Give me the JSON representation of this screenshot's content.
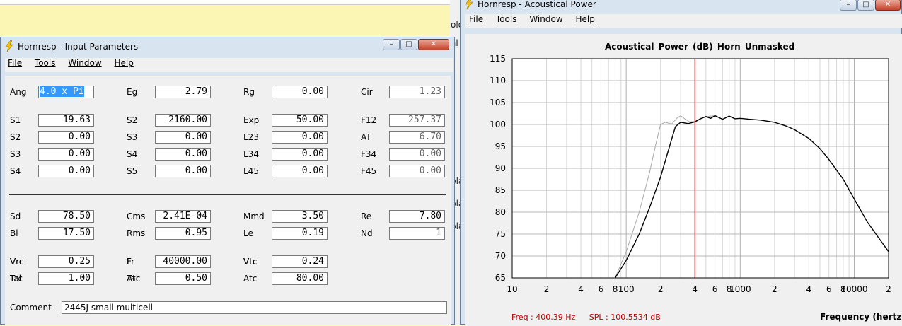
{
  "background": {
    "partial_labels": [
      "olo",
      "al",
      "pla",
      "pla",
      "pla"
    ]
  },
  "input_window": {
    "title": "Hornresp - Input Parameters",
    "menu": [
      "File",
      "Tools",
      "Window",
      "Help"
    ],
    "params": [
      {
        "label": "Ang",
        "value": "4.0 x Pi",
        "selected": true
      },
      {
        "label": "Eg",
        "value": "2.79"
      },
      {
        "label": "Rg",
        "value": "0.00"
      },
      {
        "label": "Cir",
        "value": "1.23",
        "readonly": true
      },
      {
        "label": "S1",
        "value": "19.63"
      },
      {
        "label": "S2",
        "value": "2160.00"
      },
      {
        "label": "Exp",
        "value": "50.00"
      },
      {
        "label": "F12",
        "value": "257.37",
        "readonly": true
      },
      {
        "label": "S2",
        "value": "0.00"
      },
      {
        "label": "S3",
        "value": "0.00"
      },
      {
        "label": "L23",
        "value": "0.00"
      },
      {
        "label": "AT",
        "value": "6.70",
        "readonly": true
      },
      {
        "label": "S3",
        "value": "0.00"
      },
      {
        "label": "S4",
        "value": "0.00"
      },
      {
        "label": "L34",
        "value": "0.00"
      },
      {
        "label": "F34",
        "value": "0.00",
        "readonly": true
      },
      {
        "label": "S4",
        "value": "0.00"
      },
      {
        "label": "S5",
        "value": "0.00"
      },
      {
        "label": "L45",
        "value": "0.00"
      },
      {
        "label": "F45",
        "value": "0.00",
        "readonly": true
      },
      {
        "label": "Sd",
        "value": "78.50"
      },
      {
        "label": "Cms",
        "value": "2.41E-04"
      },
      {
        "label": "Mmd",
        "value": "3.50"
      },
      {
        "label": "Re",
        "value": "7.80"
      },
      {
        "label": "Bl",
        "value": "17.50"
      },
      {
        "label": "Rms",
        "value": "0.95"
      },
      {
        "label": "Le",
        "value": "0.19"
      },
      {
        "label": "Nd",
        "value": "1",
        "readonly": true
      },
      {
        "label": "Vrc",
        "value": "0.25"
      },
      {
        "label": "Fr",
        "value": "40000.00"
      },
      {
        "label": "Vtc",
        "value": "0.24"
      },
      {
        "label": "Lrc",
        "value": "1.00"
      },
      {
        "label": "Tal",
        "value": "0.50"
      },
      {
        "label": "Atc",
        "value": "80.00"
      }
    ],
    "comment_label": "Comment",
    "comment_value": "2445J small multicell"
  },
  "chart_window": {
    "title": "Hornresp - Acoustical Power",
    "menu": [
      "File",
      "Tools",
      "Window",
      "Help"
    ],
    "chart_title": "Acoustical Power (dB)   Horn   Unmasked",
    "readout_freq": "Freq : 400.39 Hz",
    "readout_spl": "SPL : 100.5534 dB",
    "x_caption": "Frequency (hertz)"
  },
  "chart_data": {
    "type": "line",
    "title": "Acoustical Power (dB)   Horn   Unmasked",
    "xlabel": "Frequency (hertz)",
    "ylabel": "",
    "xscale": "log",
    "xlim": [
      10,
      20000
    ],
    "ylim": [
      65,
      115
    ],
    "yticks": [
      115,
      110,
      105,
      100,
      95,
      90,
      85,
      80,
      75,
      70,
      65
    ],
    "xtick_labels": [
      {
        "x": 10,
        "label": "10"
      },
      {
        "x": 20,
        "label": "2"
      },
      {
        "x": 40,
        "label": "4"
      },
      {
        "x": 60,
        "label": "6"
      },
      {
        "x": 80,
        "label": "8"
      },
      {
        "x": 100,
        "label": "100"
      },
      {
        "x": 200,
        "label": "2"
      },
      {
        "x": 400,
        "label": "4"
      },
      {
        "x": 600,
        "label": "6"
      },
      {
        "x": 800,
        "label": "8"
      },
      {
        "x": 1000,
        "label": "1000"
      },
      {
        "x": 2000,
        "label": "2"
      },
      {
        "x": 4000,
        "label": "4"
      },
      {
        "x": 6000,
        "label": "6"
      },
      {
        "x": 8000,
        "label": "8"
      },
      {
        "x": 10000,
        "label": "10000"
      },
      {
        "x": 20000,
        "label": "2"
      }
    ],
    "grid": true,
    "cursor_x": 400,
    "series": [
      {
        "color": "#000000",
        "x": [
          80,
          100,
          130,
          160,
          200,
          240,
          270,
          300,
          350,
          400,
          450,
          500,
          550,
          600,
          700,
          800,
          900,
          1000,
          1200,
          1500,
          2000,
          2500,
          3000,
          4000,
          5000,
          6000,
          8000,
          10000,
          13000,
          16000,
          20000
        ],
        "y": [
          65,
          69,
          75,
          81,
          88,
          95,
          99.5,
          100.5,
          100.2,
          100.6,
          101.3,
          101.8,
          101.4,
          102,
          101.2,
          101.9,
          101.3,
          101.4,
          101.2,
          101,
          100.5,
          99.7,
          98.8,
          96.8,
          94.5,
          92,
          87.5,
          83,
          77.8,
          74.5,
          71
        ]
      },
      {
        "color": "#a8a8a8",
        "x": [
          80,
          100,
          130,
          160,
          180,
          200,
          220,
          250,
          280,
          300,
          330,
          360,
          400,
          450,
          500,
          600
        ],
        "y": [
          65,
          71,
          80,
          89,
          95,
          100,
          100.5,
          100.1,
          101.5,
          102,
          101.2,
          100.6,
          100.7,
          101.4,
          101.8,
          102
        ]
      }
    ]
  }
}
